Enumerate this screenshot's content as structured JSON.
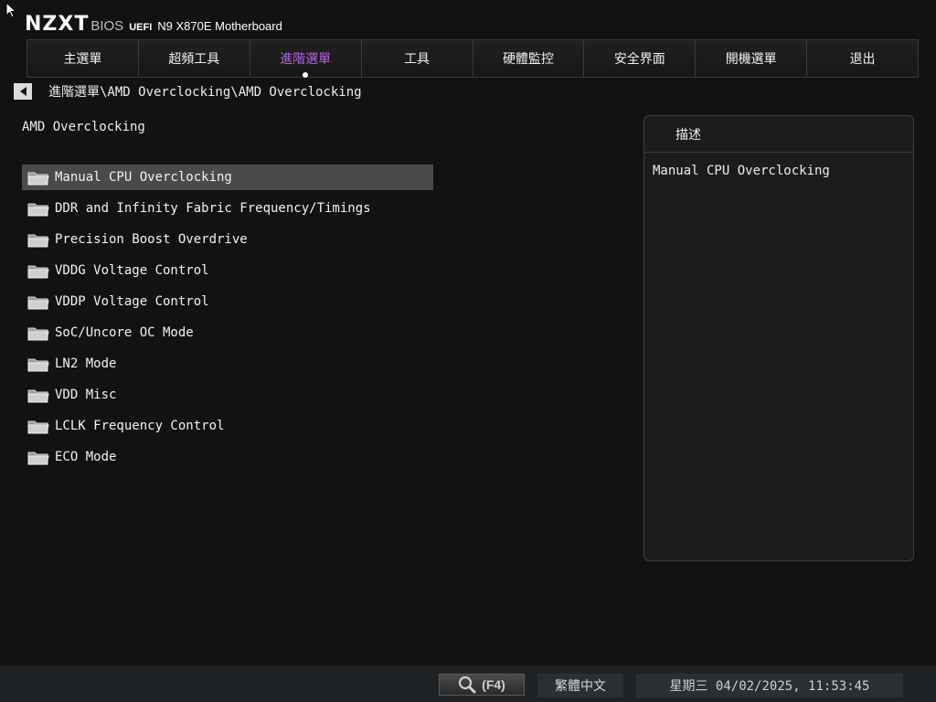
{
  "header": {
    "logo": "NZXT",
    "bios": "BIOS",
    "uefi": "UEFI",
    "model": "N9 X870E Motherboard"
  },
  "tabs": [
    {
      "label": "主選單",
      "active": false
    },
    {
      "label": "超頻工具",
      "active": false
    },
    {
      "label": "進階選單",
      "active": true
    },
    {
      "label": "工具",
      "active": false
    },
    {
      "label": "硬體監控",
      "active": false
    },
    {
      "label": "安全界面",
      "active": false
    },
    {
      "label": "開機選單",
      "active": false
    },
    {
      "label": "退出",
      "active": false
    }
  ],
  "breadcrumb": "進階選單\\AMD Overclocking\\AMD Overclocking",
  "section_title": "AMD Overclocking",
  "menu": {
    "selected_index": 0,
    "items": [
      "Manual CPU Overclocking",
      "DDR and Infinity Fabric Frequency/Timings",
      "Precision Boost Overdrive",
      "VDDG Voltage Control",
      "VDDP Voltage Control",
      "SoC/Uncore OC Mode",
      "LN2 Mode",
      "VDD Misc",
      "LCLK Frequency Control",
      "ECO Mode"
    ]
  },
  "description": {
    "title": "描述",
    "text": "Manual CPU Overclocking"
  },
  "footer": {
    "search_key": "(F4)",
    "language": "繁體中文",
    "datetime": "星期三 04/02/2025, 11:53:45"
  },
  "colors": {
    "accent": "#b366e0",
    "background": "#121212",
    "selected_row": "#4a4a4a"
  },
  "icons": {
    "back": "chevron-left-icon",
    "folder": "folder-icon",
    "search": "search-icon",
    "cursor": "mouse-pointer-icon"
  }
}
